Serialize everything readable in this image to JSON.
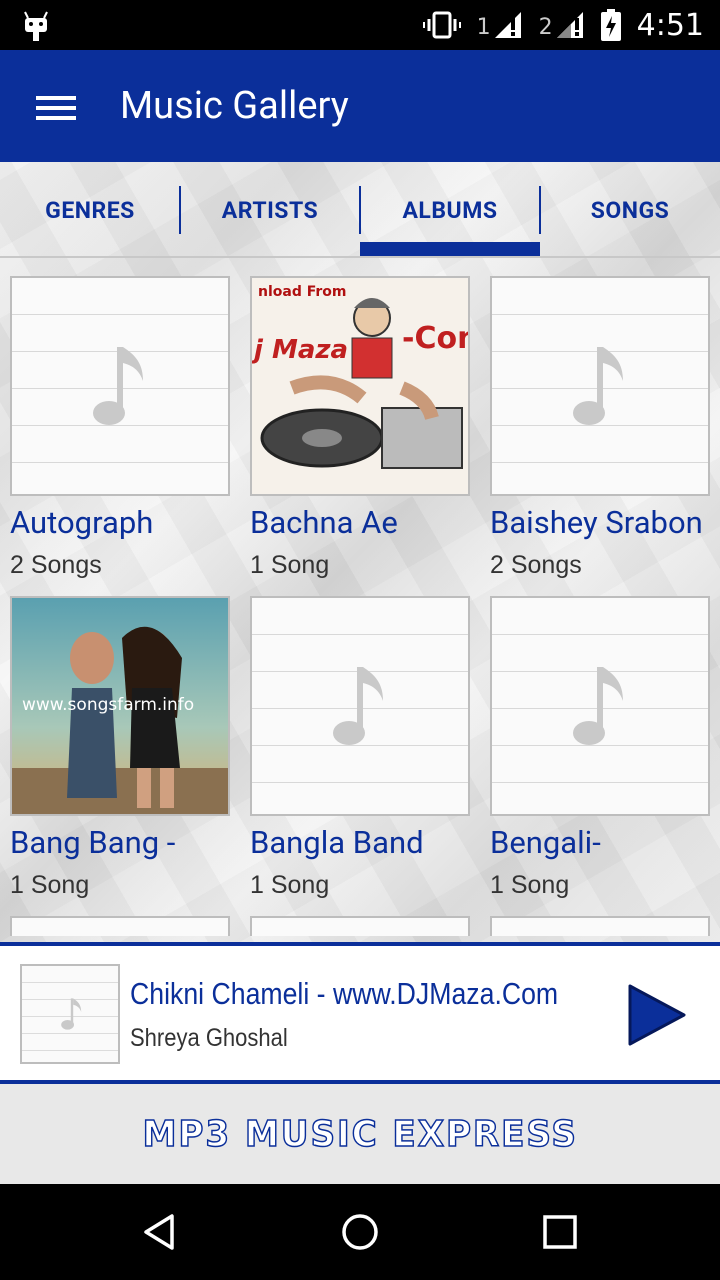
{
  "status_bar": {
    "time": "4:51",
    "sim1_label": "1",
    "sim2_label": "2",
    "icons": [
      "android-icon",
      "vibrate-icon",
      "signal-icon",
      "signal-icon",
      "battery-charging-icon"
    ]
  },
  "app_bar": {
    "title": "Music Gallery",
    "menu_icon": "hamburger-menu-icon"
  },
  "tabs": [
    {
      "label": "GENRES",
      "selected": false
    },
    {
      "label": "ARTISTS",
      "selected": false
    },
    {
      "label": "ALBUMS",
      "selected": true
    },
    {
      "label": "SONGS",
      "selected": false
    }
  ],
  "albums": [
    {
      "title": "Autograph",
      "count": "2 Songs",
      "art": "placeholder-note"
    },
    {
      "title": "Bachna Ae",
      "count": "1 Song",
      "art": "dj-maza-cover"
    },
    {
      "title": "Baishey Srabon",
      "count": "2 Songs",
      "art": "placeholder-note"
    },
    {
      "title": "Bang Bang -",
      "count": "1 Song",
      "art": "bang-bang-cover"
    },
    {
      "title": "Bangla Band",
      "count": "1 Song",
      "art": "placeholder-note"
    },
    {
      "title": "Bengali-",
      "count": "1 Song",
      "art": "placeholder-note"
    }
  ],
  "album_art_text": {
    "dj_maza_top": "nload From",
    "dj_maza_left": "j Maza",
    "dj_maza_right": "-Con",
    "songsfarm": "www.songsfarm.info"
  },
  "now_playing": {
    "title": "Chikni Chameli - www.DJMaza.Com",
    "artist": "Shreya Ghoshal",
    "play_icon": "play-icon"
  },
  "banner": {
    "text": "MP3  MUSIC EXPRESS"
  },
  "nav_bar": {
    "icons": [
      "back-icon",
      "home-icon",
      "recents-icon"
    ]
  },
  "colors": {
    "primary": "#0b2f9a",
    "background": "#f0f0f0"
  }
}
